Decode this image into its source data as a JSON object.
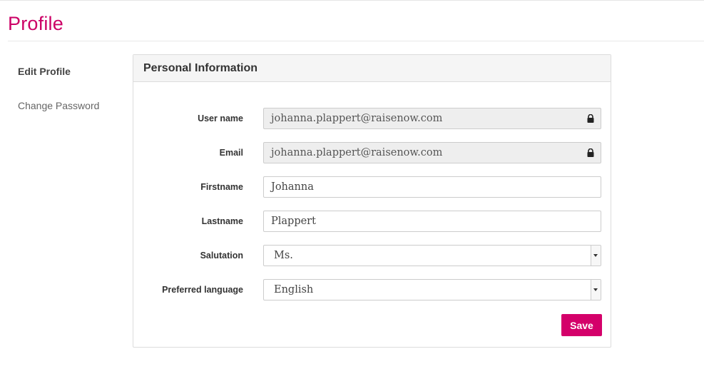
{
  "page": {
    "title": "Profile"
  },
  "sidebar": {
    "items": [
      {
        "label": "Edit Profile"
      },
      {
        "label": "Change Password"
      }
    ]
  },
  "panel": {
    "title": "Personal Information"
  },
  "form": {
    "username": {
      "label": "User name",
      "value": "johanna.plappert@raisenow.com",
      "locked": true
    },
    "email": {
      "label": "Email",
      "value": "johanna.plappert@raisenow.com",
      "locked": true
    },
    "firstname": {
      "label": "Firstname",
      "value": "Johanna"
    },
    "lastname": {
      "label": "Lastname",
      "value": "Plappert"
    },
    "salutation": {
      "label": "Salutation",
      "selected": "Ms."
    },
    "language": {
      "label": "Preferred language",
      "selected": "English"
    },
    "save_label": "Save"
  },
  "colors": {
    "accent": "#d4006a",
    "title": "#cc0066"
  }
}
